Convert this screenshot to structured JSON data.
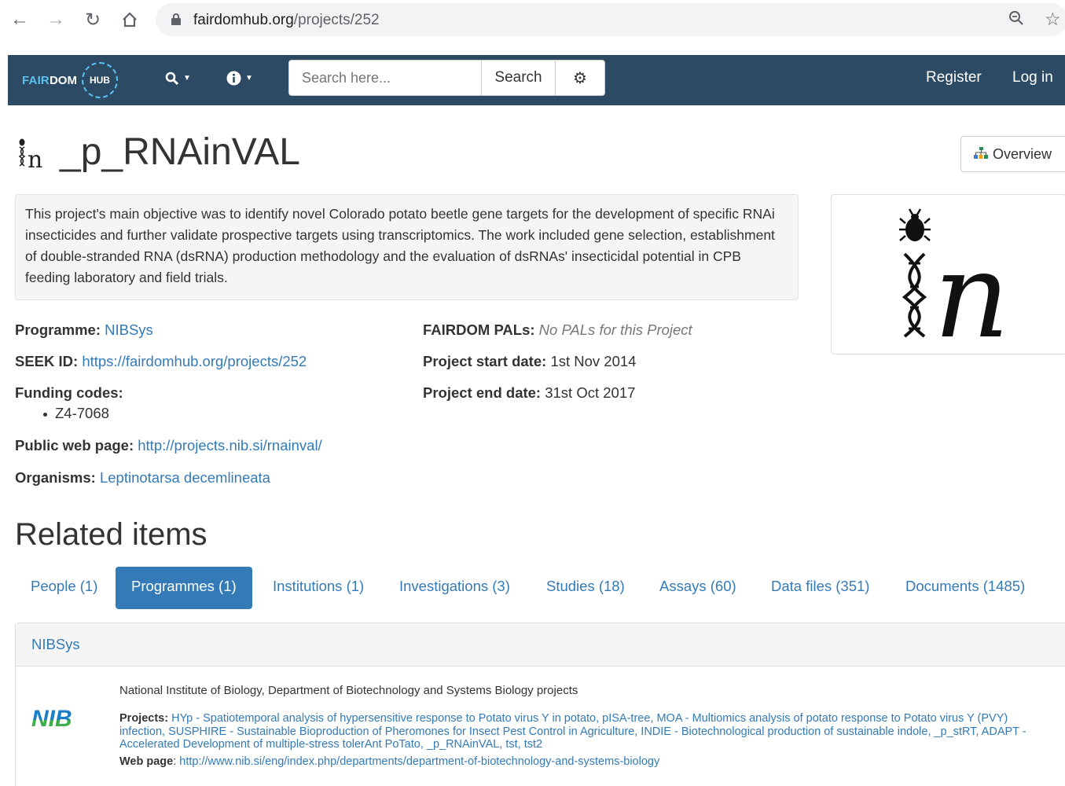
{
  "browser": {
    "url_domain": "fairdomhub.org",
    "url_path": "/projects/252"
  },
  "navbar": {
    "logo_fair": "FAIR",
    "logo_dom": "DOM",
    "logo_hub": "HUB",
    "search_placeholder": "Search here...",
    "search_button": "Search",
    "register": "Register",
    "login": "Log in"
  },
  "project": {
    "title": "_p_RNAinVAL",
    "overview_button": "Overview",
    "description": "This project's main objective was to identify novel Colorado potato beetle gene targets for the development of specific RNAi insecticides and further validate prospective targets using transcriptomics. The work included gene selection, establishment of double-stranded RNA (dsRNA) production methodology and the evaluation of dsRNAs' insecticidal potential in CPB feeding laboratory and field trials.",
    "programme_label": "Programme:",
    "programme_value": "NIBSys",
    "seek_id_label": "SEEK ID:",
    "seek_id_value": "https://fairdomhub.org/projects/252",
    "funding_label": "Funding codes:",
    "funding_codes": [
      "Z4-7068"
    ],
    "public_web_label": "Public web page:",
    "public_web_value": "http://projects.nib.si/rnainval/",
    "organisms_label": "Organisms:",
    "organisms_value": "Leptinotarsa decemlineata",
    "pals_label": "FAIRDOM PALs:",
    "pals_value": "No PALs for this Project",
    "start_label": "Project start date:",
    "start_value": "1st Nov 2014",
    "end_label": "Project end date:",
    "end_value": "31st Oct 2017"
  },
  "related": {
    "heading": "Related items",
    "tabs": [
      {
        "label": "People (1)"
      },
      {
        "label": "Programmes (1)"
      },
      {
        "label": "Institutions (1)"
      },
      {
        "label": "Investigations (3)"
      },
      {
        "label": "Studies (18)"
      },
      {
        "label": "Assays (60)"
      },
      {
        "label": "Data files (351)"
      },
      {
        "label": "Documents (1485)"
      }
    ],
    "active_tab": 1,
    "item": {
      "name": "NIBSys",
      "logo_text": "NIB",
      "description": "National Institute of Biology, Department of Biotechnology and Systems Biology projects",
      "projects_label": "Projects:",
      "projects_value": "HYp - Spatiotemporal analysis of hypersensitive response to Potato virus Y in potato, pISA-tree, MOA - Multiomics analysis of potato response to Potato virus Y (PVY) infection, SUSPHIRE - Sustainable Bioproduction of Pheromones for Insect Pest Control in Agriculture, INDIE - Biotechnological production of sustainable indole, _p_stRT, ADAPT - Accelerated Development of multiple-stress tolerAnt PoTato, _p_RNAinVAL, tst, tst2",
      "web_label": "Web page",
      "web_value": "http://www.nib.si/eng/index.php/departments/department-of-biotechnology-and-systems-biology"
    }
  },
  "colors": {
    "navbar_bg": "#2c4a63",
    "link": "#337ab7",
    "logo_accent": "#5bc0f0"
  }
}
